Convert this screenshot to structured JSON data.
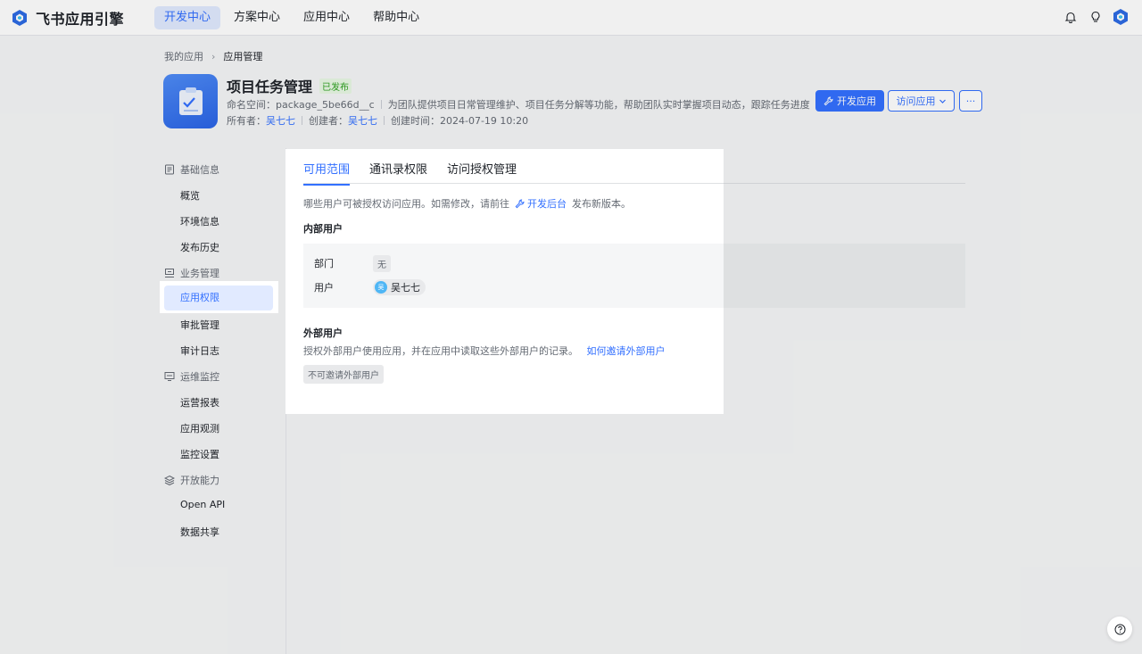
{
  "brand": {
    "name": "飞书应用引擎"
  },
  "nav": [
    "开发中心",
    "方案中心",
    "应用中心",
    "帮助中心"
  ],
  "colors": {
    "accent": "#3370ff",
    "published": "#2ea121"
  },
  "breadcrumb": {
    "root": "我的应用",
    "current": "应用管理"
  },
  "app": {
    "title": "项目任务管理",
    "status": "已发布",
    "namespace_label": "命名空间：",
    "namespace": "package_5be66d__c",
    "description": "为团队提供项目日常管理维护、项目任务分解等功能，帮助团队实时掌握项目动态，跟踪任务进度",
    "owner_label": "所有者：",
    "owner": "吴七七",
    "creator_label": "创建者：",
    "creator": "吴七七",
    "created_label": "创建时间：",
    "created": "2024-07-19 10:20"
  },
  "actions": {
    "develop": "开发应用",
    "visit": "访问应用",
    "more": "···"
  },
  "sidebar": {
    "groups": [
      {
        "label": "基础信息",
        "icon": "document-icon"
      },
      {
        "label": "业务管理",
        "icon": "business-icon"
      },
      {
        "label": "运维监控",
        "icon": "monitor-icon"
      },
      {
        "label": "开放能力",
        "icon": "layers-icon"
      }
    ],
    "items": [
      "概览",
      "环境信息",
      "发布历史",
      "应用权限",
      "审批管理",
      "审计日志",
      "运营报表",
      "应用观测",
      "监控设置",
      "Open API",
      "数据共享"
    ]
  },
  "panel": {
    "tabs": [
      "可用范围",
      "通讯录权限",
      "访问授权管理"
    ],
    "desc_prefix": "哪些用户可被授权访问应用。如需修改，请前往",
    "desc_link": "开发后台",
    "desc_suffix": "发布新版本。",
    "internal_title": "内部用户",
    "dept_label": "部门",
    "dept_value": "无",
    "user_label": "用户",
    "user_value": "吴七七",
    "user_avatar": "吴",
    "external_title": "外部用户",
    "external_desc": "授权外部用户使用应用，并在应用中读取这些外部用户的记录。",
    "external_link": "如何邀请外部用户",
    "external_tag": "不可邀请外部用户"
  }
}
